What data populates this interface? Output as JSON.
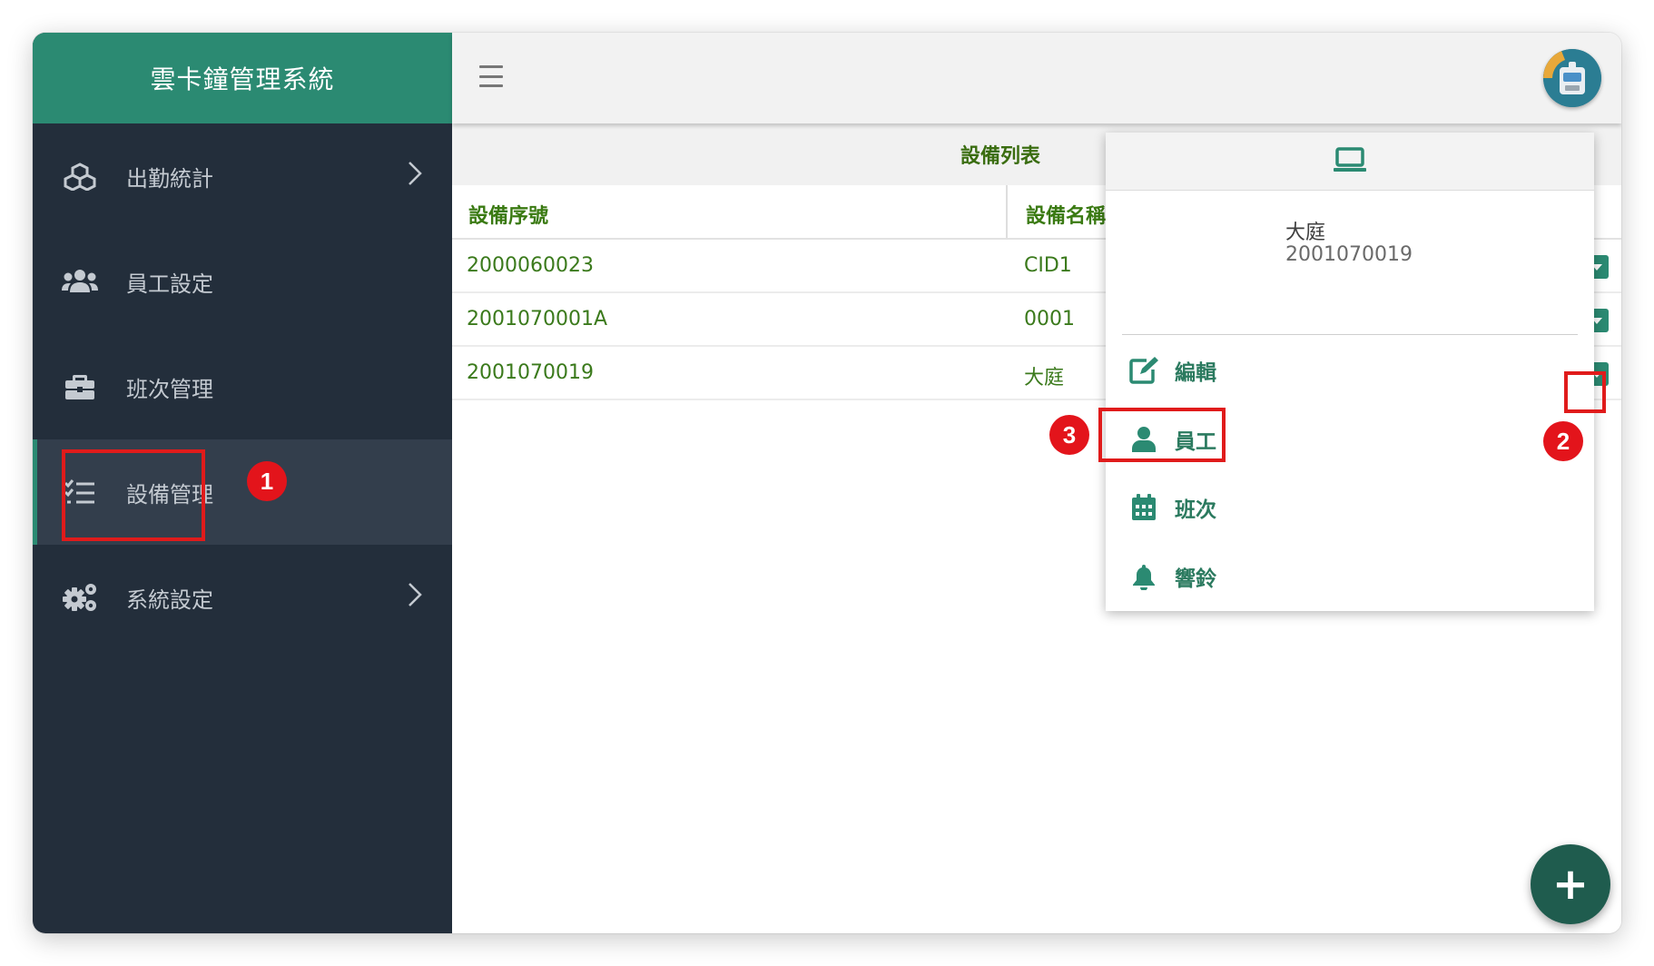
{
  "app": {
    "title": "雲卡鐘管理系統"
  },
  "sidebar": {
    "items": [
      {
        "label": "出勤統計",
        "icon": "cubes-icon",
        "has_submenu": true
      },
      {
        "label": "員工設定",
        "icon": "users-icon",
        "has_submenu": false
      },
      {
        "label": "班次管理",
        "icon": "briefcase-icon",
        "has_submenu": false
      },
      {
        "label": "設備管理",
        "icon": "list-check-icon",
        "has_submenu": false,
        "active": true
      },
      {
        "label": "系統設定",
        "icon": "cogs-icon",
        "has_submenu": true
      }
    ]
  },
  "topbar": {
    "menu_icon": "hamburger-icon",
    "avatar_icon": "device-avatar-icon"
  },
  "table": {
    "title": "設備列表",
    "columns": [
      "設備序號",
      "設備名稱"
    ],
    "rows": [
      {
        "serial": "2000060023",
        "name": "CID1"
      },
      {
        "serial": "2001070001A",
        "name": "0001"
      },
      {
        "serial": "2001070019",
        "name": "大庭"
      }
    ]
  },
  "popup": {
    "header_icon": "laptop-icon",
    "device_name": "大庭",
    "device_serial": "2001070019",
    "items": [
      {
        "label": "編輯",
        "icon": "edit-icon"
      },
      {
        "label": "員工",
        "icon": "user-icon"
      },
      {
        "label": "班次",
        "icon": "calendar-icon"
      },
      {
        "label": "響鈴",
        "icon": "bell-icon"
      }
    ]
  },
  "annotations": {
    "badges": [
      "1",
      "2",
      "3"
    ],
    "color": "#e3141b"
  },
  "fab": {
    "label": "+"
  },
  "colors": {
    "brand": "#2b8a72",
    "sidebar_bg": "#232e3b",
    "sidebar_active": "#333e4c",
    "text_green": "#3b7a1c",
    "fab": "#1f5c4e"
  }
}
